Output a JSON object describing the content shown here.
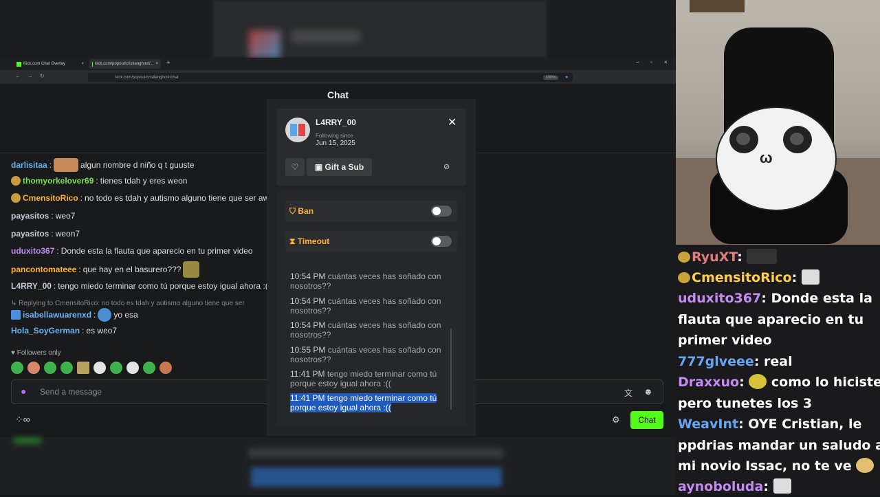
{
  "browser": {
    "tabs": [
      {
        "label": "Kick.com Chat Overlay"
      },
      {
        "label": "kick.com/popout/cristianghost/..."
      }
    ],
    "url": "kick.com/popout/cristianghost/chat",
    "zoom": "100%"
  },
  "chat": {
    "header": "Chat",
    "messages": [
      {
        "user": "darlisitaa",
        "text": "algun nombre d niño q t guuste"
      },
      {
        "user": "thomyorkelover69",
        "text": "tienes tdah y eres weon"
      },
      {
        "user": "CmensitoRico",
        "text": "no todo es tdah y autismo alguno tiene que ser awe"
      },
      {
        "user": "payasitos",
        "text": "weo7"
      },
      {
        "user": "payasitos",
        "text": "weon7"
      },
      {
        "user": "uduxito367",
        "text": "Donde esta la flauta que aparecio en tu primer video"
      },
      {
        "user": "pancontomateee",
        "text": "que hay en el basurero???"
      },
      {
        "user": "L4RRY_00",
        "text": "tengo miedo terminar como tú porque estoy igual ahora :(("
      },
      {
        "reply_to": "Replying to CmensitoRico: no todo es tdah y autismo alguno tiene que ser",
        "user": "isabellawuarenxd",
        "text": "yo esa"
      },
      {
        "user": "Hola_SoyGerman",
        "text": "es weo7"
      }
    ],
    "followers_only": "Followers only",
    "input_placeholder": "Send a message",
    "send_label": "Chat"
  },
  "modal": {
    "username": "L4RRY_00",
    "following_since_label": "Following since",
    "following_since_date": "Jun 15, 2025",
    "gift_label": "Gift a Sub",
    "ban_label": "Ban",
    "timeout_label": "Timeout",
    "history": [
      {
        "time": "10:54 PM",
        "text": "cuántas veces has soñado con nosotros??"
      },
      {
        "time": "10:54 PM",
        "text": "cuántas veces has soñado con nosotros??"
      },
      {
        "time": "10:54 PM",
        "text": "cuántas veces has soñado con nosotros??"
      },
      {
        "time": "10:55 PM",
        "text": "cuántas veces has soñado con nosotros??"
      },
      {
        "time": "11:41 PM",
        "text": "tengo miedo terminar como tú porque estoy igual ahora :(("
      },
      {
        "time": "11:41 PM",
        "text": "tengo miedo terminar como tú porque estoy igual ahora :(("
      }
    ]
  },
  "overlay": {
    "lines": [
      {
        "user": "RyuXT",
        "text": ""
      },
      {
        "user": "CmensitoRico",
        "text": ""
      },
      {
        "user": "uduxito367",
        "text": "Donde esta la"
      },
      {
        "text": "flauta que aparecio en tu"
      },
      {
        "text": "primer video"
      },
      {
        "user": "777glveee",
        "text": "real"
      },
      {
        "user": "Draxxuo",
        "text": "como lo hiciste"
      },
      {
        "text": "pero tunetes los 3"
      },
      {
        "user": "WeavInt",
        "text": "OYE Cristian, le"
      },
      {
        "text": "ppdrias mandar un saludo a"
      },
      {
        "text": "mi novio Issac, no te ve"
      },
      {
        "user": "aynoboluda",
        "text": ""
      }
    ]
  }
}
